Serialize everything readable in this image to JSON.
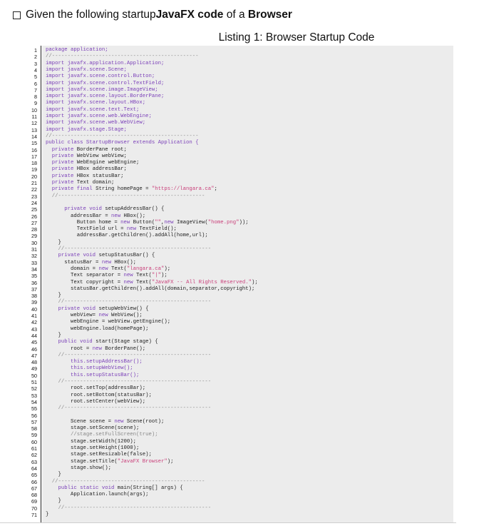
{
  "question": {
    "prefix": "Given the following startup ",
    "bold1": "JavaFX code",
    "middle": " of a ",
    "bold2": "Browser"
  },
  "listing_caption": "Listing 1: Browser Startup Code",
  "code_lines": [
    [
      {
        "t": "package application;",
        "c": "kw-first"
      }
    ],
    [
      {
        "t": "//-----------------------------------------------",
        "c": "cm"
      }
    ],
    [
      {
        "t": "import",
        "c": "kw"
      },
      {
        "t": " javafx.application.Application;",
        "c": "kw"
      }
    ],
    [
      {
        "t": "import javafx.scene.Scene;",
        "c": "kw"
      }
    ],
    [
      {
        "t": "import javafx.scene.control.Button;",
        "c": "kw"
      }
    ],
    [
      {
        "t": "import javafx.scene.control.TextField;",
        "c": "kw"
      }
    ],
    [
      {
        "t": "import javafx.scene.image.ImageView;",
        "c": "kw"
      }
    ],
    [
      {
        "t": "import javafx.scene.layout.BorderPane;",
        "c": "kw"
      }
    ],
    [
      {
        "t": "import javafx.scene.layout.HBox;",
        "c": "kw"
      }
    ],
    [
      {
        "t": "import javafx.scene.text.Text;",
        "c": "kw"
      }
    ],
    [
      {
        "t": "import javafx.scene.web.WebEngine;",
        "c": "kw"
      }
    ],
    [
      {
        "t": "import javafx.scene.web.WebView;",
        "c": "kw"
      }
    ],
    [
      {
        "t": "import javafx.stage.Stage;",
        "c": "kw"
      }
    ],
    [
      {
        "t": "//-----------------------------------------------",
        "c": "cm"
      }
    ],
    [
      {
        "t": "public class StartupBrowser extends Application {",
        "c": "kw"
      }
    ],
    [
      {
        "t": "  private",
        "c": "kw"
      },
      {
        "t": " BorderPane root;",
        "c": ""
      }
    ],
    [
      {
        "t": "  private",
        "c": "kw"
      },
      {
        "t": " WebView webView;",
        "c": ""
      }
    ],
    [
      {
        "t": "  private",
        "c": "kw"
      },
      {
        "t": " WebEngine webEngine;",
        "c": ""
      }
    ],
    [
      {
        "t": "  private",
        "c": "kw"
      },
      {
        "t": " HBox addressBar;",
        "c": ""
      }
    ],
    [
      {
        "t": "  private",
        "c": "kw"
      },
      {
        "t": " HBox statusBar;",
        "c": ""
      }
    ],
    [
      {
        "t": "  private",
        "c": "kw"
      },
      {
        "t": " Text domain;",
        "c": ""
      }
    ],
    [
      {
        "t": "  private final",
        "c": "kw"
      },
      {
        "t": " String homePage = ",
        "c": ""
      },
      {
        "t": "\"https://langara.ca\"",
        "c": "st"
      },
      {
        "t": ";",
        "c": ""
      }
    ],
    [
      {
        "t": "  //-----------------------------------------------",
        "c": "cm"
      }
    ],
    [
      {
        "t": "",
        "c": ""
      }
    ],
    [
      {
        "t": "      private void",
        "c": "kw"
      },
      {
        "t": " setupAddressBar() {",
        "c": ""
      }
    ],
    [
      {
        "t": "        addressBar = ",
        "c": ""
      },
      {
        "t": "new",
        "c": "kw"
      },
      {
        "t": " HBox();",
        "c": ""
      }
    ],
    [
      {
        "t": "          Button home = ",
        "c": ""
      },
      {
        "t": "new",
        "c": "kw"
      },
      {
        "t": " Button(",
        "c": ""
      },
      {
        "t": "\"\"",
        "c": "st"
      },
      {
        "t": ",",
        "c": ""
      },
      {
        "t": "new",
        "c": "kw"
      },
      {
        "t": " ImageView(",
        "c": ""
      },
      {
        "t": "\"home.png\"",
        "c": "st"
      },
      {
        "t": "));",
        "c": ""
      }
    ],
    [
      {
        "t": "          TextField url = ",
        "c": ""
      },
      {
        "t": "new",
        "c": "kw"
      },
      {
        "t": " TextField();",
        "c": ""
      }
    ],
    [
      {
        "t": "          addressBar.getChildren().addAll(home,url);",
        "c": ""
      }
    ],
    [
      {
        "t": "    }",
        "c": ""
      }
    ],
    [
      {
        "t": "    //-----------------------------------------------",
        "c": "cm"
      }
    ],
    [
      {
        "t": "    private void",
        "c": "kw"
      },
      {
        "t": " setupStatusBar() {",
        "c": ""
      }
    ],
    [
      {
        "t": "      statusBar = ",
        "c": ""
      },
      {
        "t": "new",
        "c": "kw"
      },
      {
        "t": " HBox();",
        "c": ""
      }
    ],
    [
      {
        "t": "        domain = ",
        "c": ""
      },
      {
        "t": "new",
        "c": "kw"
      },
      {
        "t": " Text(",
        "c": ""
      },
      {
        "t": "\"langara.ca\"",
        "c": "st"
      },
      {
        "t": ");",
        "c": ""
      }
    ],
    [
      {
        "t": "        Text separator = ",
        "c": ""
      },
      {
        "t": "new",
        "c": "kw"
      },
      {
        "t": " Text(",
        "c": ""
      },
      {
        "t": "\"|\"",
        "c": "st"
      },
      {
        "t": ");",
        "c": ""
      }
    ],
    [
      {
        "t": "        Text copyright = ",
        "c": ""
      },
      {
        "t": "new",
        "c": "kw"
      },
      {
        "t": " Text(",
        "c": ""
      },
      {
        "t": "\"JavaFX -- All Rights Reserved.\"",
        "c": "st"
      },
      {
        "t": ");",
        "c": ""
      }
    ],
    [
      {
        "t": "        statusBar.getChildren().addAll(domain,separator,copyright);",
        "c": ""
      }
    ],
    [
      {
        "t": "    }",
        "c": ""
      }
    ],
    [
      {
        "t": "    //-----------------------------------------------",
        "c": "cm"
      }
    ],
    [
      {
        "t": "    private void",
        "c": "kw"
      },
      {
        "t": " setupWebView() {",
        "c": ""
      }
    ],
    [
      {
        "t": "        webView= ",
        "c": ""
      },
      {
        "t": "new",
        "c": "kw"
      },
      {
        "t": " WebView();",
        "c": ""
      }
    ],
    [
      {
        "t": "        webEngine = webView.getEngine();",
        "c": ""
      }
    ],
    [
      {
        "t": "        webEngine.load(homePage);",
        "c": ""
      }
    ],
    [
      {
        "t": "    }",
        "c": ""
      }
    ],
    [
      {
        "t": "    public void",
        "c": "kw"
      },
      {
        "t": " start(Stage stage) {",
        "c": ""
      }
    ],
    [
      {
        "t": "        root = ",
        "c": ""
      },
      {
        "t": "new",
        "c": "kw"
      },
      {
        "t": " BorderPane();",
        "c": ""
      }
    ],
    [
      {
        "t": "    //-----------------------------------------------",
        "c": "cm"
      }
    ],
    [
      {
        "t": "        this",
        "c": "kw"
      },
      {
        "t": ".setupAddressBar();",
        "c": "kw"
      }
    ],
    [
      {
        "t": "        this",
        "c": "kw"
      },
      {
        "t": ".setupWebView();",
        "c": "kw"
      }
    ],
    [
      {
        "t": "        this",
        "c": "kw"
      },
      {
        "t": ".setupStatusBar();",
        "c": "kw"
      }
    ],
    [
      {
        "t": "    //-----------------------------------------------",
        "c": "cm"
      }
    ],
    [
      {
        "t": "        root.setTop(addressBar);",
        "c": ""
      }
    ],
    [
      {
        "t": "        root.setBottom(statusBar);",
        "c": ""
      }
    ],
    [
      {
        "t": "        root.setCenter(webView);",
        "c": ""
      }
    ],
    [
      {
        "t": "    //-----------------------------------------------",
        "c": "cm"
      }
    ],
    [
      {
        "t": "",
        "c": ""
      }
    ],
    [
      {
        "t": "        Scene scene = ",
        "c": ""
      },
      {
        "t": "new",
        "c": "kw"
      },
      {
        "t": " Scene(root);",
        "c": ""
      }
    ],
    [
      {
        "t": "        stage.setScene(scene);",
        "c": ""
      }
    ],
    [
      {
        "t": "        //stage.setFullScreen(true);",
        "c": "cm"
      }
    ],
    [
      {
        "t": "        stage.setWidth(1200);",
        "c": ""
      }
    ],
    [
      {
        "t": "        stage.setHeight(1000);",
        "c": ""
      }
    ],
    [
      {
        "t": "        stage.setResizable(false);",
        "c": ""
      }
    ],
    [
      {
        "t": "        stage.setTitle(",
        "c": ""
      },
      {
        "t": "\"JavaFX Browser\"",
        "c": "st"
      },
      {
        "t": ");",
        "c": ""
      }
    ],
    [
      {
        "t": "        stage.show();",
        "c": ""
      }
    ],
    [
      {
        "t": "    }",
        "c": ""
      }
    ],
    [
      {
        "t": "  //-----------------------------------------------",
        "c": "cm"
      }
    ],
    [
      {
        "t": "    public static void",
        "c": "kw"
      },
      {
        "t": " main(String[] args) {",
        "c": ""
      }
    ],
    [
      {
        "t": "        Application.launch(args);",
        "c": ""
      }
    ],
    [
      {
        "t": "    }",
        "c": ""
      }
    ],
    [
      {
        "t": "    //-----------------------------------------------",
        "c": "cm"
      }
    ],
    [
      {
        "t": "}",
        "c": ""
      }
    ]
  ],
  "colors": {
    "keyword": "#7a3fb8",
    "comment": "#888888",
    "string": "#c9407a",
    "code_background": "#ececec"
  }
}
